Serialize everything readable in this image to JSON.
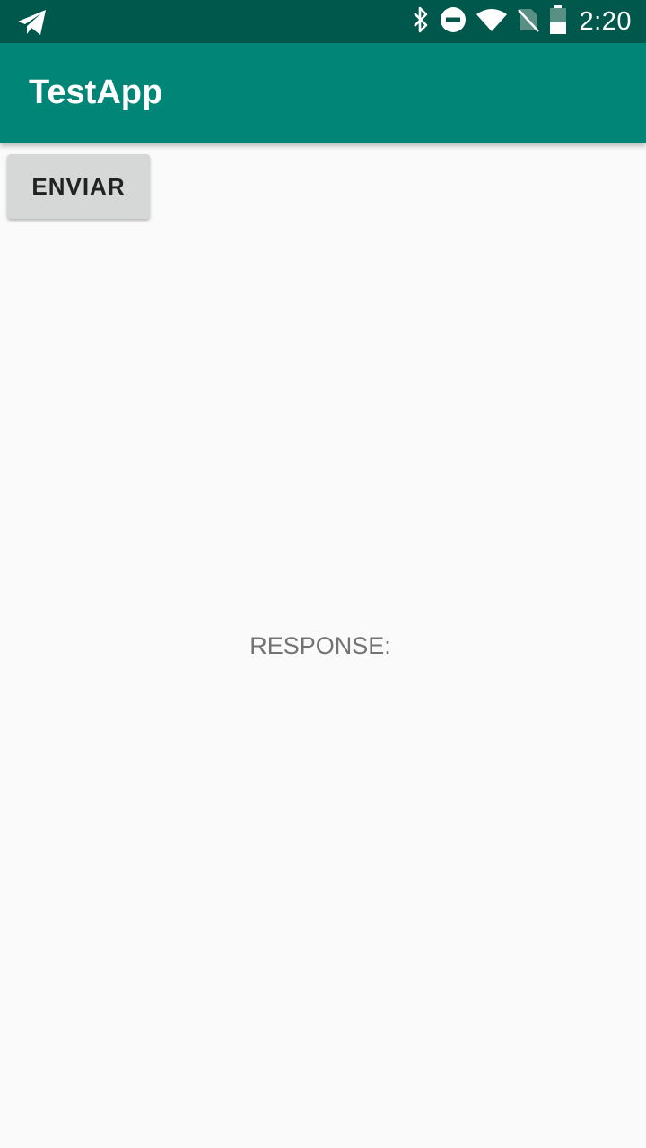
{
  "status_bar": {
    "time": "2:20",
    "icons": [
      "telegram-icon",
      "bluetooth-icon",
      "do-not-disturb-icon",
      "wifi-icon",
      "no-sim-icon",
      "battery-icon"
    ]
  },
  "app_bar": {
    "title": "TestApp"
  },
  "main": {
    "send_button_label": "ENVIAR",
    "response_label": "RESPONSE:"
  },
  "colors": {
    "status_bar": "#00574b",
    "app_bar": "#008577",
    "background": "#fafafa",
    "button": "#d6d7d7"
  }
}
